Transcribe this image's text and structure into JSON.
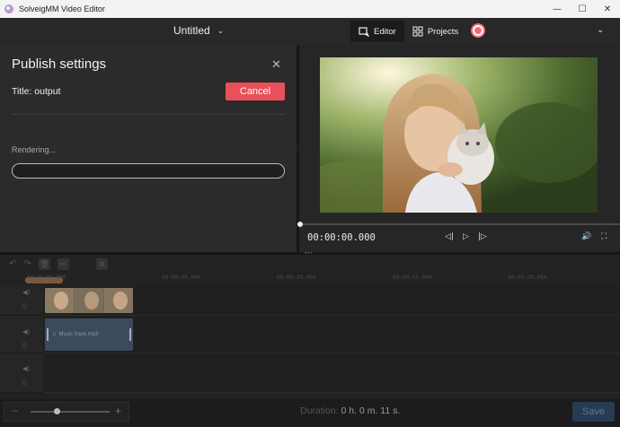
{
  "window": {
    "app_title": "SolveigMM Video Editor",
    "minimize_glyph": "—",
    "maximize_glyph": "☐",
    "close_glyph": "✕"
  },
  "header": {
    "document_title": "Untitled",
    "title_chevron": "⌄",
    "tabs": [
      {
        "label": "Editor",
        "icon": "editor-icon",
        "active": true
      },
      {
        "label": "Projects",
        "icon": "grid-icon",
        "active": false
      }
    ],
    "menu_chevron": "⌄"
  },
  "publish": {
    "heading": "Publish settings",
    "close_glyph": "✕",
    "title_line": "Title: output",
    "cancel_label": "Cancel",
    "status_label": "Rendering...",
    "progress": 0
  },
  "player": {
    "timecode": "00:00:00.000",
    "prev_glyph": "◁|",
    "play_glyph": "▷",
    "next_glyph": "|▷",
    "volume_glyph": "🔊",
    "fullscreen_glyph": "⛶"
  },
  "timeline": {
    "toolbar": {
      "undo_glyph": "↶",
      "redo_glyph": "↷",
      "delete_glyph": "🗑",
      "split_glyph": "✂",
      "settings_glyph": "⚙"
    },
    "ruler_labels": [
      "00:00:00.000",
      "00:00:05.000",
      "00:00:10.000",
      "00:00:15.000",
      "00:00:20.000"
    ],
    "audio_clip_label": "Music track.mp3",
    "audio_clip_glyph": "♫"
  },
  "footer": {
    "zoom_minus": "−",
    "zoom_plus": "+",
    "zoom_level": 0.33,
    "duration_label": "Duration:",
    "duration_value": "0 h. 0 m. 11 s.",
    "save_label": "Save"
  },
  "colors": {
    "accent": "#e9505a",
    "avatar": "#ef6b7b",
    "save_disabled": "#263c52"
  }
}
